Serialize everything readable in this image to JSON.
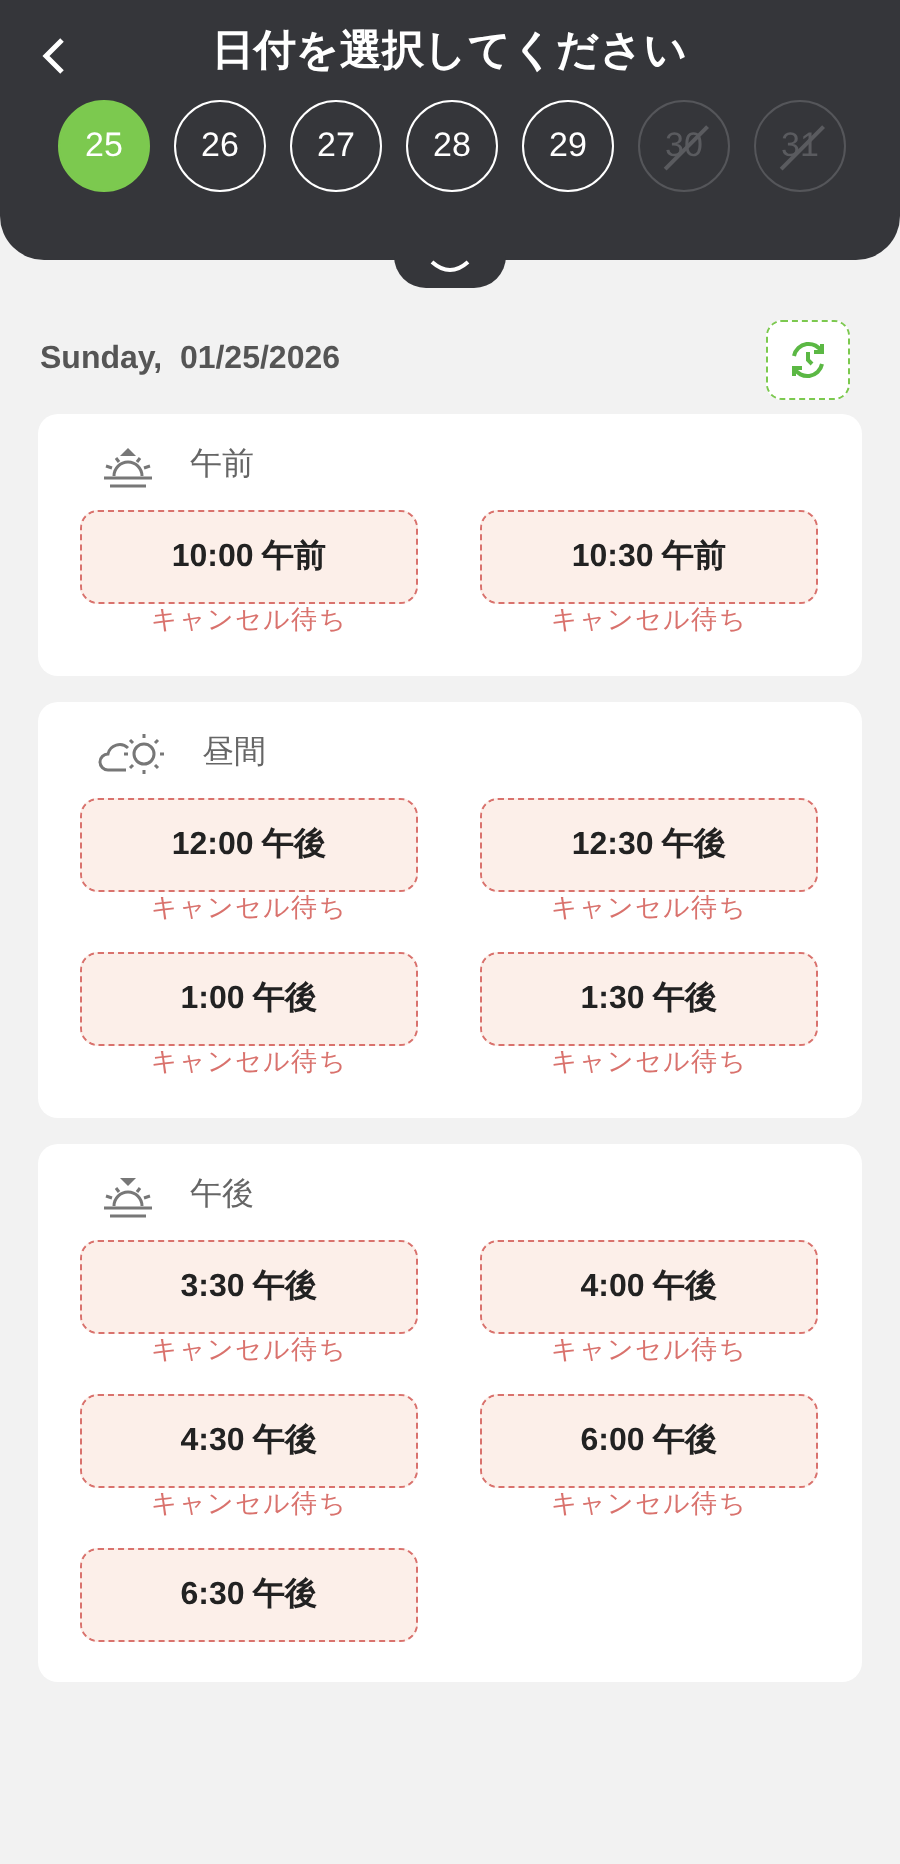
{
  "header": {
    "title": "日付を選択してください"
  },
  "days": [
    {
      "label": "25",
      "selected": true,
      "disabled": false
    },
    {
      "label": "26",
      "selected": false,
      "disabled": false
    },
    {
      "label": "27",
      "selected": false,
      "disabled": false
    },
    {
      "label": "28",
      "selected": false,
      "disabled": false
    },
    {
      "label": "29",
      "selected": false,
      "disabled": false
    },
    {
      "label": "30",
      "selected": false,
      "disabled": true
    },
    {
      "label": "31",
      "selected": false,
      "disabled": true
    }
  ],
  "date_label": "Sunday,  01/25/2026",
  "periods": [
    {
      "kind": "morning",
      "label": "午前",
      "slots": [
        {
          "time": "10:00 午前",
          "status": "キャンセル待ち"
        },
        {
          "time": "10:30 午前",
          "status": "キャンセル待ち"
        }
      ]
    },
    {
      "kind": "midday",
      "label": "昼間",
      "slots": [
        {
          "time": "12:00 午後",
          "status": "キャンセル待ち"
        },
        {
          "time": "12:30 午後",
          "status": "キャンセル待ち"
        },
        {
          "time": "1:00 午後",
          "status": "キャンセル待ち"
        },
        {
          "time": "1:30 午後",
          "status": "キャンセル待ち"
        }
      ]
    },
    {
      "kind": "evening",
      "label": "午後",
      "slots": [
        {
          "time": "3:30 午後",
          "status": "キャンセル待ち"
        },
        {
          "time": "4:00 午後",
          "status": "キャンセル待ち"
        },
        {
          "time": "4:30 午後",
          "status": "キャンセル待ち"
        },
        {
          "time": "6:00 午後",
          "status": "キャンセル待ち"
        },
        {
          "time": "6:30 午後"
        }
      ]
    }
  ]
}
